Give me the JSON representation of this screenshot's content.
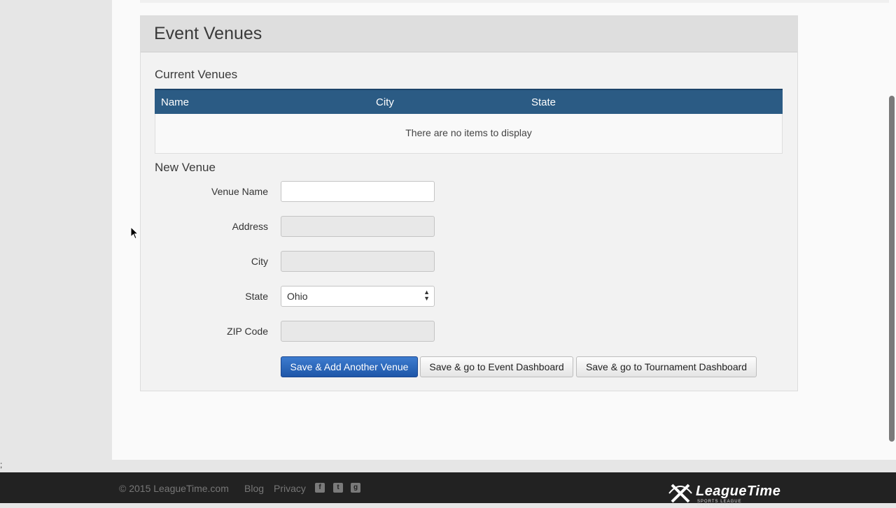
{
  "panel": {
    "title": "Event Venues",
    "current_venues_title": "Current Venues",
    "table": {
      "columns": [
        "Name",
        "City",
        "State"
      ],
      "empty_message": "There are no items to display"
    },
    "new_venue_title": "New Venue",
    "form": {
      "venue_name_label": "Venue Name",
      "venue_name_value": "",
      "address_label": "Address",
      "address_value": "",
      "city_label": "City",
      "city_value": "",
      "state_label": "State",
      "state_value": "Ohio",
      "zip_label": "ZIP Code",
      "zip_value": ""
    },
    "buttons": {
      "save_add_another": "Save & Add Another Venue",
      "save_event_dashboard": "Save & go to Event Dashboard",
      "save_tournament_dashboard": "Save & go to Tournament Dashboard"
    }
  },
  "footer": {
    "copyright": "© 2015 LeagueTime.com",
    "links": [
      "Blog",
      "Privacy"
    ],
    "social_icons": [
      "facebook-icon",
      "twitter-icon",
      "google-plus-icon"
    ],
    "logo_text": "LeagueTime",
    "logo_subtext": "SPORTS LEAGUE MANAGEMENT"
  },
  "misc": {
    "corner_text": ";"
  },
  "colors": {
    "table_header": "#2b5b84",
    "primary_button": "#1e56a8",
    "footer_bg": "#222222"
  }
}
